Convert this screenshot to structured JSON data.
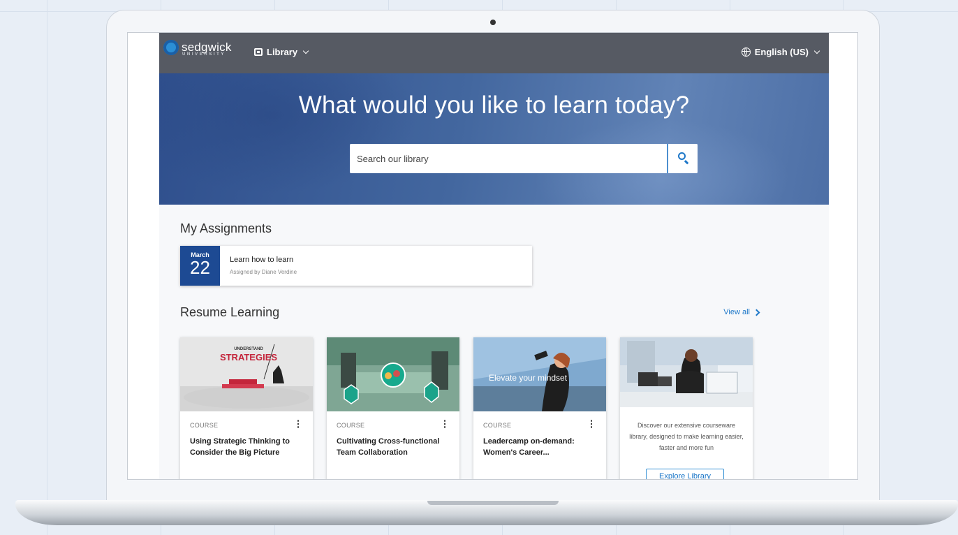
{
  "brand": {
    "name": "sedgwick",
    "subtitle": "UNIVERSITY",
    "accent_color": "#1d4a93"
  },
  "nav": {
    "library_label": "Library",
    "language_label": "English (US)"
  },
  "hero": {
    "title": "What would you like to learn today?",
    "search_placeholder": "Search our library"
  },
  "assignments": {
    "heading": "My Assignments",
    "items": [
      {
        "month": "March",
        "day": "22",
        "title": "Learn how to learn",
        "assigned_by": "Assigned by Diane Verdine"
      }
    ]
  },
  "resume": {
    "heading": "Resume Learning",
    "view_all_label": "View all",
    "cards": [
      {
        "type": "COURSE",
        "title": "Using Strategic Thinking to Consider the Big Picture",
        "image_text_1": "UNDERSTAND",
        "image_text_2": "STRATEGIES"
      },
      {
        "type": "COURSE",
        "title": "Cultivating Cross-functional Team Collaboration"
      },
      {
        "type": "COURSE",
        "title": "Leadercamp on-demand: Women's Career...",
        "image_text": "Elevate your mindset"
      }
    ],
    "promo": {
      "text": "Discover our extensive courseware library, designed to make learning easier, faster and more fun",
      "button_label": "Explore Library"
    }
  }
}
